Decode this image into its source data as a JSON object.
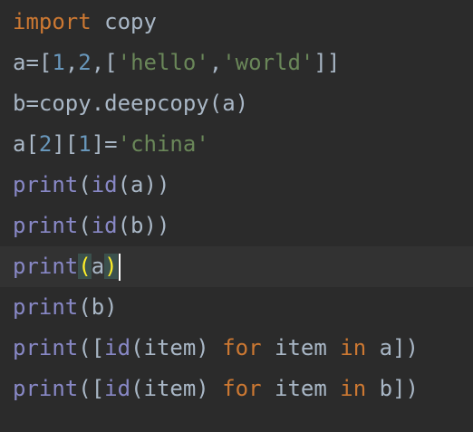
{
  "editor": {
    "lines": [
      {
        "tokens": [
          {
            "t": "import",
            "c": "kw"
          },
          {
            "t": " copy",
            "c": "id"
          }
        ]
      },
      {
        "tokens": [
          {
            "t": "a=",
            "c": "id"
          },
          {
            "t": "[",
            "c": "punct"
          },
          {
            "t": "1",
            "c": "num"
          },
          {
            "t": ",",
            "c": "punct"
          },
          {
            "t": "2",
            "c": "num"
          },
          {
            "t": ",",
            "c": "punct"
          },
          {
            "t": "[",
            "c": "punct"
          },
          {
            "t": "'hello'",
            "c": "str"
          },
          {
            "t": ",",
            "c": "punct"
          },
          {
            "t": "'world'",
            "c": "str"
          },
          {
            "t": "]]",
            "c": "punct"
          }
        ]
      },
      {
        "tokens": [
          {
            "t": "b=copy.deepcopy(a)",
            "c": "id"
          }
        ]
      },
      {
        "tokens": [
          {
            "t": "a",
            "c": "id"
          },
          {
            "t": "[",
            "c": "punct"
          },
          {
            "t": "2",
            "c": "num"
          },
          {
            "t": "][",
            "c": "punct"
          },
          {
            "t": "1",
            "c": "num"
          },
          {
            "t": "]=",
            "c": "punct"
          },
          {
            "t": "'china'",
            "c": "str"
          }
        ]
      },
      {
        "tokens": [
          {
            "t": "print",
            "c": "builtin"
          },
          {
            "t": "(",
            "c": "punct"
          },
          {
            "t": "id",
            "c": "builtin"
          },
          {
            "t": "(a))",
            "c": "punct"
          }
        ]
      },
      {
        "tokens": [
          {
            "t": "print",
            "c": "builtin"
          },
          {
            "t": "(",
            "c": "punct"
          },
          {
            "t": "id",
            "c": "builtin"
          },
          {
            "t": "(b))",
            "c": "punct"
          }
        ]
      },
      {
        "current": true,
        "tokens": [
          {
            "t": "print",
            "c": "builtin"
          },
          {
            "t": "(",
            "c": "match"
          },
          {
            "t": "a",
            "c": "id"
          },
          {
            "t": ")",
            "c": "match"
          },
          {
            "t": "",
            "c": "caret"
          }
        ]
      },
      {
        "tokens": [
          {
            "t": "print",
            "c": "builtin"
          },
          {
            "t": "(b)",
            "c": "punct"
          }
        ]
      },
      {
        "tokens": [
          {
            "t": "print",
            "c": "builtin"
          },
          {
            "t": "([",
            "c": "punct"
          },
          {
            "t": "id",
            "c": "builtin"
          },
          {
            "t": "(item) ",
            "c": "punct"
          },
          {
            "t": "for",
            "c": "kw"
          },
          {
            "t": " item ",
            "c": "id"
          },
          {
            "t": "in",
            "c": "kw"
          },
          {
            "t": " a])",
            "c": "id"
          }
        ]
      },
      {
        "tokens": [
          {
            "t": "print",
            "c": "builtin"
          },
          {
            "t": "([",
            "c": "punct"
          },
          {
            "t": "id",
            "c": "builtin"
          },
          {
            "t": "(item) ",
            "c": "punct"
          },
          {
            "t": "for",
            "c": "kw"
          },
          {
            "t": " item ",
            "c": "id"
          },
          {
            "t": "in",
            "c": "kw"
          },
          {
            "t": " b])",
            "c": "id"
          }
        ]
      }
    ]
  },
  "colors": {
    "background": "#2b2b2b",
    "current_line": "#323232",
    "keyword": "#cc7832",
    "identifier": "#a9b7c6",
    "number": "#6897bb",
    "string": "#6a8759",
    "builtin": "#8888c6",
    "bracket_match_bg": "#3b514d",
    "bracket_match_fg": "#ffef28"
  }
}
